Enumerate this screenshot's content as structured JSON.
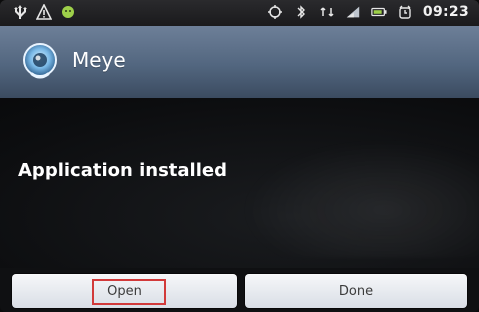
{
  "status_bar": {
    "left_icons": [
      "usb-icon",
      "warning-icon",
      "android-icon"
    ],
    "right_icons": [
      "gps-icon",
      "bluetooth-icon",
      "data-icon",
      "signal-icon",
      "battery-icon",
      "alarm-icon"
    ],
    "time": "09:23"
  },
  "app": {
    "title": "Meye",
    "icon": "meye-app-icon"
  },
  "dialog": {
    "message": "Application installed",
    "buttons": {
      "open": "Open",
      "done": "Done"
    }
  },
  "colors": {
    "header_top": "#6d7f98",
    "header_bottom": "#3b4b60",
    "button_bg": "#e9edf2",
    "highlight": "#d23a3a"
  }
}
